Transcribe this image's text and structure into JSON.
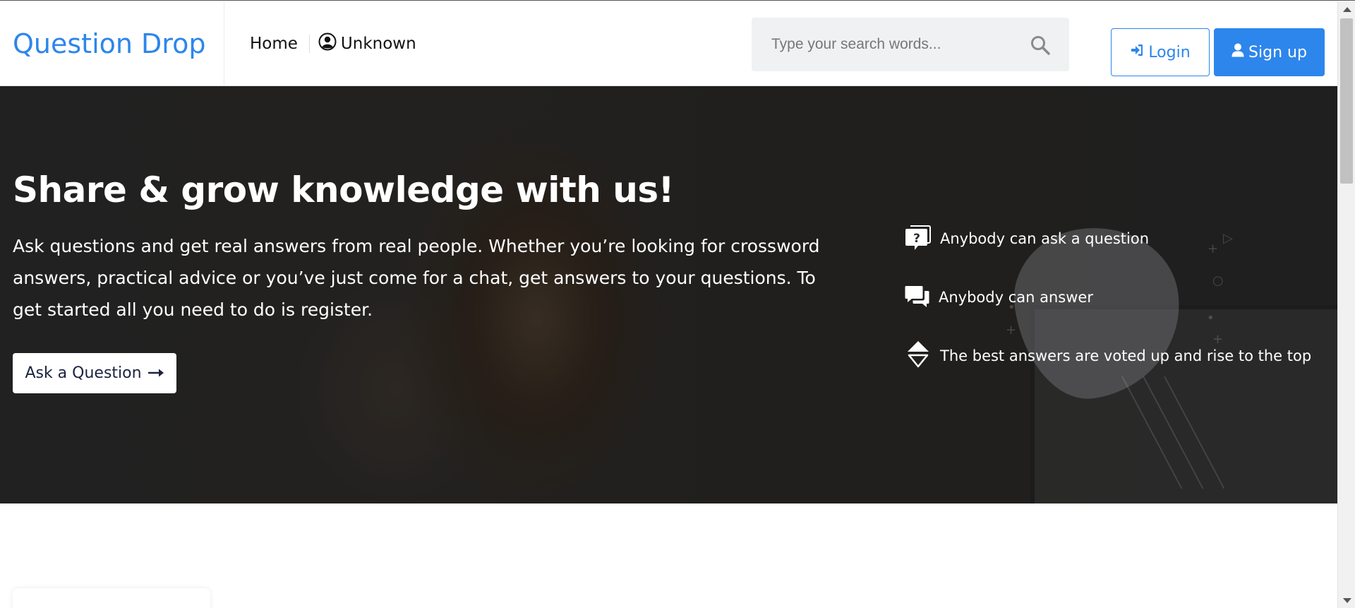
{
  "header": {
    "logo": "Question Drop",
    "nav": {
      "home": "Home",
      "user": "Unknown"
    },
    "search": {
      "placeholder": "Type your search words..."
    },
    "login_label": "Login",
    "signup_label": "Sign up"
  },
  "hero": {
    "title": "Share & grow knowledge with us!",
    "description": "Ask questions and get real answers from real people. Whether you’re looking for crossword answers, practical advice or you’ve just come for a chat, get answers to your questions. To get started all you need to do is register.",
    "ask_button": "Ask a Question",
    "features": [
      {
        "label": "Anybody can ask a question",
        "icon": "question-bubble-icon"
      },
      {
        "label": "Anybody can answer",
        "icon": "chat-bubbles-icon"
      },
      {
        "label": "The best answers are voted up and rise to the top",
        "icon": "vote-arrows-icon"
      }
    ]
  },
  "colors": {
    "brand": "#2d86eb",
    "hero_bg": "#2b2a29",
    "button_text": "#1b2340"
  }
}
